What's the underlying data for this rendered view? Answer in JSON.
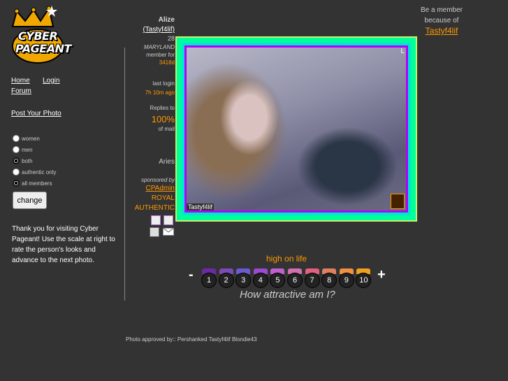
{
  "logo": {
    "line1": "CYBER",
    "line2": "PAGEANT"
  },
  "nav": {
    "home": "Home",
    "login": "Login",
    "forum": "Forum",
    "post_photo": "Post Your Photo"
  },
  "filters": {
    "options": [
      "women",
      "men",
      "both",
      "authentic only",
      "all members"
    ],
    "checked": [
      "both",
      "all members"
    ],
    "change_label": "change"
  },
  "thank_you": "Thank you for visiting Cyber Pageant! Use the scale at right to rate the person's looks and advance to the next photo.",
  "member": {
    "name": "Alize",
    "username": "(Tastyf4lif)",
    "age": "28",
    "location": "MARYLAND",
    "member_for_label": "member for",
    "member_for_value": "3418d",
    "last_login_label": "last login",
    "last_login_value": "7h 10m ago",
    "replies_label": "Replies to",
    "replies_value": "100%",
    "replies_suffix": "of mail",
    "sign": "Aries",
    "sponsored_label": "sponsored by",
    "sponsor": "CPAdmin",
    "badge_line1": "ROYAL",
    "badge_line2": "AUTHENTIC"
  },
  "photo": {
    "caption": "Tastyf4lif",
    "corner_mark": "L"
  },
  "rating": {
    "label": "high on life",
    "minus": "-",
    "plus": "+",
    "scores": [
      "1",
      "2",
      "3",
      "4",
      "5",
      "6",
      "7",
      "8",
      "9",
      "10"
    ],
    "tab_colors": [
      "#6a2aa0",
      "#7a4ab8",
      "#6a5acd",
      "#9a4ad0",
      "#c060d0",
      "#d070b0",
      "#e06080",
      "#e08060",
      "#f09040",
      "#f0a020"
    ],
    "question": "How attractive am I?"
  },
  "approved": "Photo approved by:: Pershanked Tastyf4lif Blondie43",
  "be_member": {
    "line1": "Be a member",
    "line2": "because of",
    "link": "Tastyf4lif"
  }
}
